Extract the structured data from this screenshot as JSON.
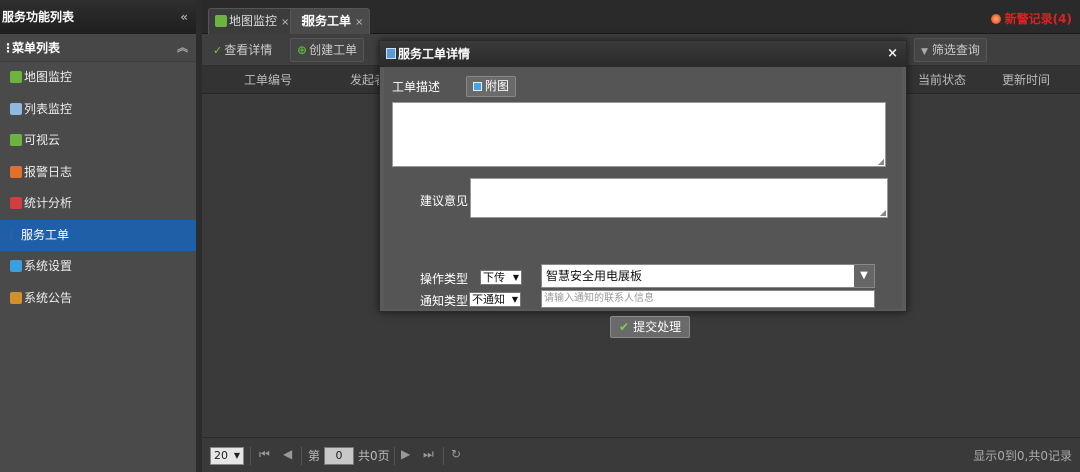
{
  "left_panel": {
    "header": "服务功能列表",
    "collapse_icon": "«",
    "menu_title": "菜单列表",
    "menu_toggle_icon": "︽",
    "items": [
      {
        "label": "地图监控",
        "icon": "map-icon",
        "color": "#6cb33f"
      },
      {
        "label": "列表监控",
        "icon": "list-icon",
        "color": "#8fb7e0"
      },
      {
        "label": "可视云",
        "icon": "cloud-map-icon",
        "color": "#6cb33f"
      },
      {
        "label": "报警日志",
        "icon": "alarm-log-icon",
        "color": "#e0702a"
      },
      {
        "label": "统计分析",
        "icon": "pie-chart-icon",
        "color": "#d04040"
      },
      {
        "label": "服务工单",
        "icon": "work-order-icon",
        "color": "#2a5fb0",
        "active": true
      },
      {
        "label": "系统设置",
        "icon": "gear-icon",
        "color": "#3aa0e0"
      },
      {
        "label": "系统公告",
        "icon": "notice-icon",
        "color": "#d0902a"
      }
    ]
  },
  "tabs": [
    {
      "label": "地图监控",
      "close": "×"
    },
    {
      "label": "服务工单",
      "close": "×"
    }
  ],
  "alarm": {
    "label": "新警记录(4)",
    "color": "#e02020"
  },
  "toolbar": {
    "view_details": "查看详情",
    "create_order": "创建工单",
    "filter_query": "筛选查询"
  },
  "table": {
    "columns": [
      "工单编号",
      "发起者",
      "当前状态",
      "更新时间"
    ]
  },
  "pager": {
    "page_size": "20",
    "page_label_before": "第",
    "page_value": "0",
    "page_label_after": "共0页",
    "summary": "显示0到0,共0记录"
  },
  "dialog": {
    "title": "服务工单详情",
    "close": "×",
    "description_label": "工单描述",
    "attach_label": "附图",
    "suggestion_label": "建议意见",
    "operation_type_label": "操作类型",
    "operation_type_value": "下传",
    "product_value": "智慧安全用电展板",
    "notify_type_label": "通知类型",
    "notify_type_value": "不通知",
    "notify_placeholder": "请输入通知的联系人信息",
    "submit_label": "提交处理"
  }
}
